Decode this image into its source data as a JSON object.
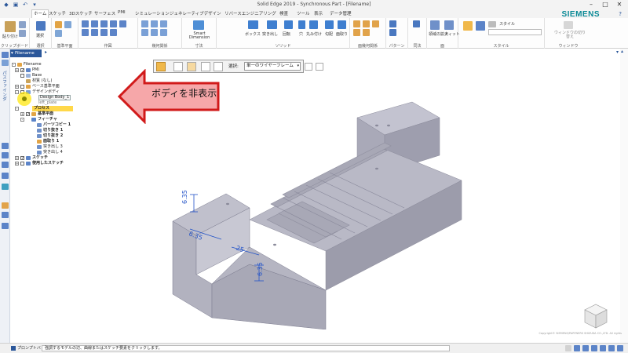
{
  "window": {
    "title": "Solid Edge 2019 - Synchronous Part - [Filename]"
  },
  "menu": {
    "tabs": [
      {
        "label": "ホーム"
      },
      {
        "label": "スケッチ"
      },
      {
        "label": "3Dスケッチ"
      },
      {
        "label": "サーフェス"
      },
      {
        "label": "PMI"
      },
      {
        "label": "シミュレーション"
      },
      {
        "label": "ジェネレーティブデザイン"
      },
      {
        "label": "リバースエンジニアリング"
      },
      {
        "label": "検査"
      },
      {
        "label": "ツール"
      },
      {
        "label": "表示"
      },
      {
        "label": "データ管理"
      }
    ],
    "brand": "SIEMENS"
  },
  "ribbon": {
    "groups": [
      {
        "label": "クリップボード",
        "button": "貼り付け"
      },
      {
        "label": "選択",
        "button": "選択"
      },
      {
        "label": "基準平面"
      },
      {
        "label": "作図"
      },
      {
        "label": "幾何関係"
      },
      {
        "label": "寸法",
        "button": "Smart Dimension"
      },
      {
        "label": "ソリッド",
        "buttons": [
          "ボックス",
          "突き出し",
          "回転",
          "穴",
          "丸み付け",
          "勾配",
          "面取り"
        ]
      },
      {
        "label": "面幾何関係"
      },
      {
        "label": "パターン"
      },
      {
        "label": "同法"
      },
      {
        "label": "面",
        "buttons": [
          "領域の拡大",
          "フィット"
        ]
      },
      {
        "label": "スタイル",
        "button": "スタイル"
      },
      {
        "label": "ウィンドウ",
        "button": "ウィンドウの切り替え"
      }
    ]
  },
  "pathfinder": {
    "tab_label": "Filename",
    "side_label": "パスファインダ",
    "tree": [
      {
        "label": "Filename",
        "bold": false
      },
      {
        "label": "PMI",
        "bold": false
      },
      {
        "label": "Base",
        "bold": false
      },
      {
        "label": "材質 (なし)",
        "bold": false
      },
      {
        "label": "ベース基準平面",
        "bold": false
      },
      {
        "label": "デザインボディ",
        "bold": false
      },
      {
        "label": "Design Body_1",
        "bold": false
      },
      {
        "label": "left_plate",
        "bold": false
      },
      {
        "label": "プロセス",
        "bold": true
      },
      {
        "label": "基準平面",
        "bold": true
      },
      {
        "label": "フィーチャ",
        "bold": true
      },
      {
        "label": "パーツコピー 1",
        "bold": true
      },
      {
        "label": "切り抜き 1",
        "bold": true
      },
      {
        "label": "切り抜き 2",
        "bold": true
      },
      {
        "label": "面取り 1",
        "bold": true
      },
      {
        "label": "突き出し 3",
        "bold": false
      },
      {
        "label": "突き出し 4",
        "bold": false
      },
      {
        "label": "スケッチ",
        "bold": true
      },
      {
        "label": "使用したスケッチ",
        "bold": true
      }
    ]
  },
  "command_bar": {
    "select_label": "選択:",
    "select_value": "単一のワイヤーフレーム"
  },
  "callout": {
    "text": "ボディを非表示"
  },
  "dimensions": {
    "d1": "6.35",
    "d2": "6.35",
    "d3": "25",
    "d4": "6.35"
  },
  "status": {
    "prompt_label": "プロンプトバー",
    "message": "強調するモデルの辺、曲線またはスケッチ要素をクリックします。"
  },
  "copyright": "Copyright© SIEMENS/PARTNERS SHIZUKA CO.,LTD. All rights",
  "colors": {
    "accent": "#2b579a",
    "siemens": "#0a8a96",
    "callout_fill": "#f6a7a9",
    "callout_stroke": "#d11a1a",
    "highlight": "#ffd84a",
    "model_top": "#b9b9c6",
    "model_front": "#a8a8b6",
    "model_side": "#9c9cab",
    "dimension": "#2454c8"
  }
}
